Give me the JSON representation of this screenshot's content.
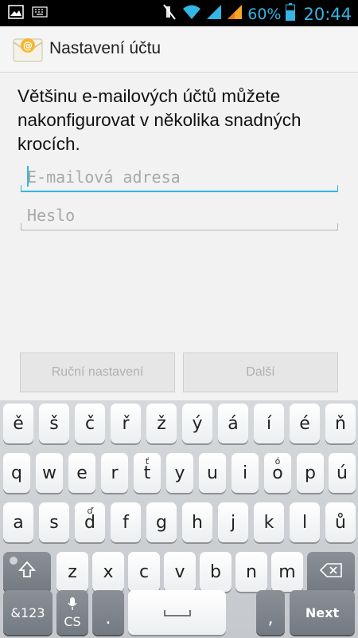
{
  "status_bar": {
    "battery_pct": "60%",
    "time": "20:44"
  },
  "action_bar": {
    "title": "Nastavení účtu"
  },
  "intro_text": "Většinu e-mailových účtů můžete nakonfigurovat v několika snadných krocích.",
  "fields": {
    "email_placeholder": "E-mailová adresa",
    "password_placeholder": "Heslo"
  },
  "buttons": {
    "manual": "Ruční nastavení",
    "next": "Další"
  },
  "keyboard": {
    "row1": [
      "ě",
      "š",
      "č",
      "ř",
      "ž",
      "ý",
      "á",
      "í",
      "é",
      "ň"
    ],
    "row2": [
      "q",
      "w",
      "e",
      "r",
      "t",
      "y",
      "u",
      "i",
      "o",
      "p",
      "ú"
    ],
    "row2_hint_t": "ť",
    "row2_hint_o": "ó",
    "row3": [
      "a",
      "s",
      "d",
      "f",
      "g",
      "h",
      "j",
      "k",
      "l",
      "ů"
    ],
    "row3_hint_d": "ď",
    "row4": [
      "z",
      "x",
      "c",
      "v",
      "b",
      "n",
      "m"
    ],
    "symbols_label": "&123",
    "lang_label": "CS",
    "period": ".",
    "comma": ",",
    "next_label": "Next",
    "icons": {
      "shift": "shift-icon",
      "backspace": "backspace-icon",
      "mic": "microphone-icon",
      "space": "space-icon"
    }
  }
}
